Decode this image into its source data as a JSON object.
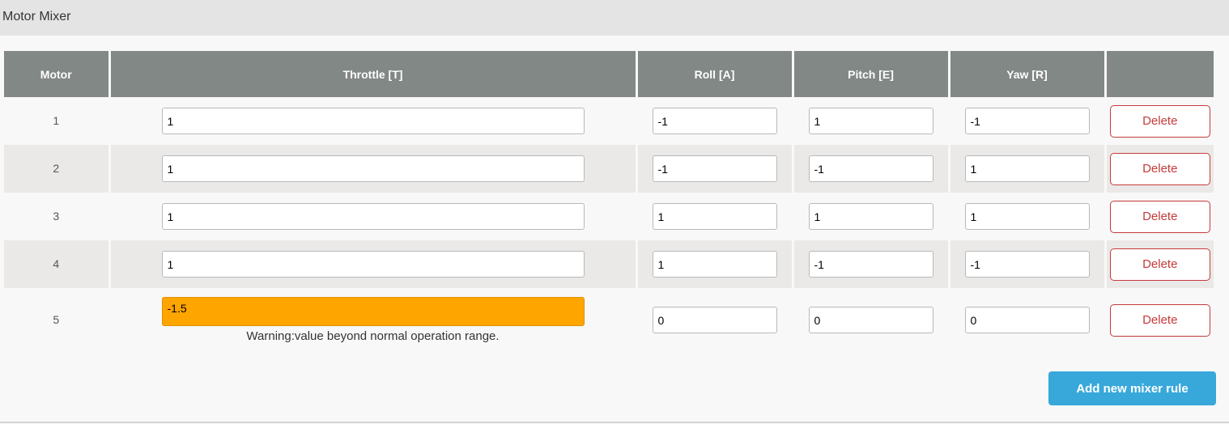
{
  "panel": {
    "title": "Motor Mixer"
  },
  "table": {
    "headers": [
      "Motor",
      "Throttle [T]",
      "Roll [A]",
      "Pitch [E]",
      "Yaw [R]",
      ""
    ],
    "rows": [
      {
        "motor": "1",
        "throttle": "1",
        "roll": "-1",
        "pitch": "1",
        "yaw": "-1",
        "delete_label": "Delete"
      },
      {
        "motor": "2",
        "throttle": "1",
        "roll": "-1",
        "pitch": "-1",
        "yaw": "1",
        "delete_label": "Delete"
      },
      {
        "motor": "3",
        "throttle": "1",
        "roll": "1",
        "pitch": "1",
        "yaw": "1",
        "delete_label": "Delete"
      },
      {
        "motor": "4",
        "throttle": "1",
        "roll": "1",
        "pitch": "-1",
        "yaw": "-1",
        "delete_label": "Delete"
      },
      {
        "motor": "5",
        "throttle": "-1.5",
        "roll": "0",
        "pitch": "0",
        "yaw": "0",
        "delete_label": "Delete",
        "warning": "Warning:value beyond normal operation range."
      }
    ]
  },
  "actions": {
    "add_label": "Add new mixer rule"
  },
  "colors": {
    "header_bg": "#828885",
    "warning_bg": "#ffa500",
    "delete_accent": "#c43a3a",
    "add_button_bg": "#38a8db"
  }
}
